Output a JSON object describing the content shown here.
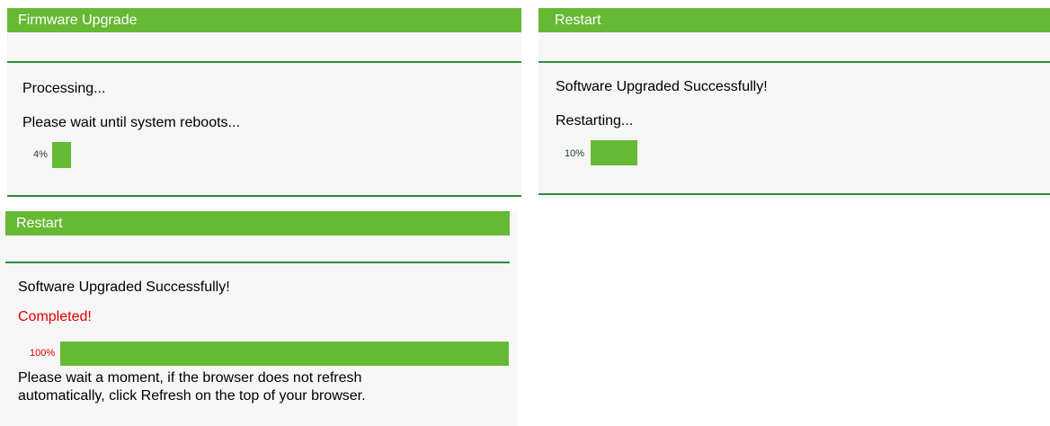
{
  "panel1": {
    "title": "Firmware Upgrade",
    "line1": "Processing...",
    "line2": "Please wait until system reboots...",
    "progress_label": "4%",
    "progress": 0.04
  },
  "panel2": {
    "title": "Restart",
    "line1": "Software Upgraded Successfully!",
    "line2": "Restarting...",
    "progress_label": "10%",
    "progress": 0.1
  },
  "panel3": {
    "title": "Restart",
    "line1": "Software Upgraded Successfully!",
    "status": "Completed!",
    "progress_label": "100%",
    "progress": 1.0,
    "note_line1": "Please wait a moment, if the browser does not refresh",
    "note_line2": "automatically, click Refresh on the top of your browser."
  },
  "colors": {
    "accent": "#66b933",
    "rule": "#2e8b3e",
    "panel_bg": "#f6f6f6",
    "completed": "#e00000"
  }
}
